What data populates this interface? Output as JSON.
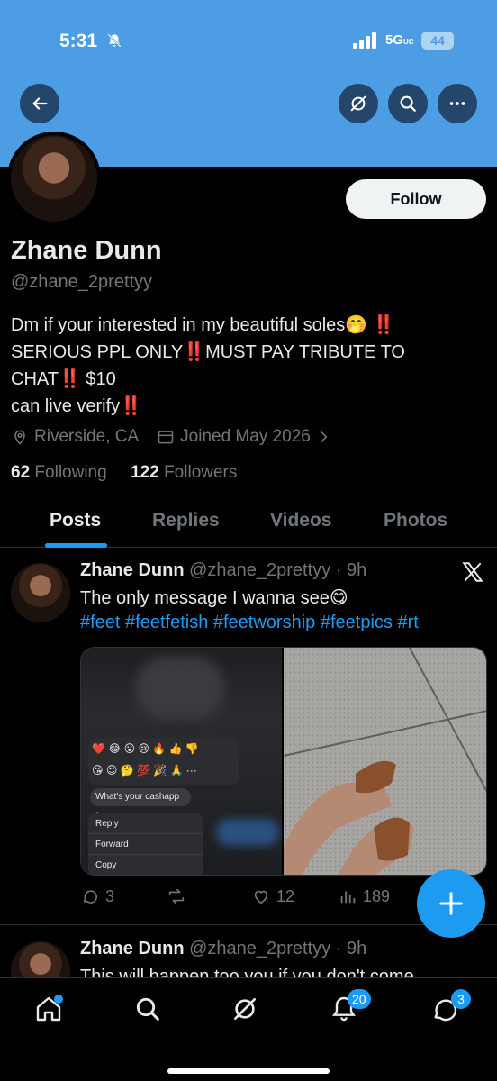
{
  "status_bar": {
    "time": "5:31",
    "network": "5G",
    "network_suffix": "UC",
    "battery": "44"
  },
  "profile": {
    "name": "Zhane Dunn",
    "handle": "@zhane_2prettyy",
    "bio_lines": [
      "Dm if your interested in my beautiful soles🤭 ‼️",
      "SERIOUS PPL ONLY‼️MUST PAY TRIBUTE TO",
      "CHAT‼️ $10",
      "can live verify‼️"
    ],
    "location": "Riverside, CA",
    "joined": "Joined May 2026",
    "following_count": "62",
    "following_label": "Following",
    "followers_count": "122",
    "followers_label": "Followers",
    "follow_label": "Follow"
  },
  "tabs": [
    {
      "label": "Posts",
      "active": true
    },
    {
      "label": "Replies",
      "active": false
    },
    {
      "label": "Videos",
      "active": false
    },
    {
      "label": "Photos",
      "active": false
    }
  ],
  "posts": [
    {
      "name": "Zhane Dunn",
      "handle_time": "@zhane_2prettyy · 9h",
      "text": "The only message I wanna see😋",
      "tags": "#feet #feetfetish #feetworship #feetpics #rt",
      "media": {
        "emoji_row1": "❤️ 😂 😮 😢 🔥 👍 👎",
        "emoji_row2": "😘 😍 🤔 💯 🎉 🙏 ···",
        "bubble_text": "What's your cashapp",
        "bubble_time": "1m",
        "menu": [
          "Reply",
          "Forward",
          "Copy"
        ]
      },
      "replies": "3",
      "retweets": "",
      "likes": "12",
      "views": "189"
    },
    {
      "name": "Zhane Dunn",
      "handle_time": "@zhane_2prettyy · 9h",
      "text": "This will happen too you if you don't come"
    }
  ],
  "nav": {
    "notifications_badge": "20",
    "messages_badge": "3"
  },
  "colors": {
    "banner": "#4c9de4",
    "accent": "#1d9bf0",
    "background": "#000000",
    "muted": "#71767b"
  }
}
